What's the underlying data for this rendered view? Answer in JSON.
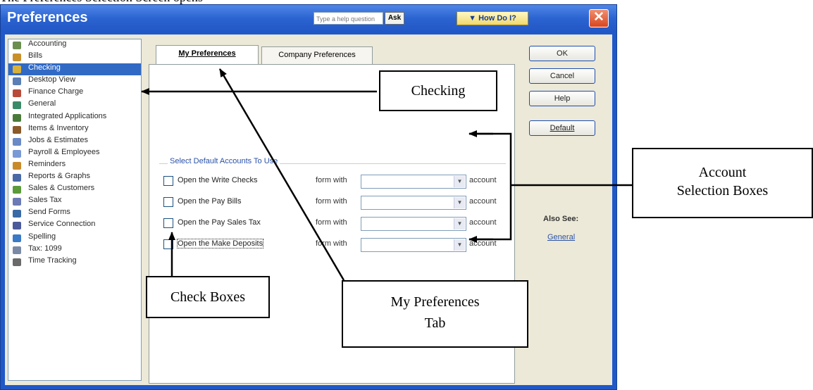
{
  "caption": "The Preferences Selection Screen opens",
  "window": {
    "title": "Preferences",
    "help_placeholder": "Type a help question",
    "ask_label": "Ask",
    "howdo_label": "▼ How Do I?",
    "close_glyph": "✕"
  },
  "sidebar": {
    "items": [
      {
        "label": "Accounting",
        "icon": "accounting-icon",
        "color": "#6b8e4e"
      },
      {
        "label": "Bills",
        "icon": "bills-icon",
        "color": "#c9902a"
      },
      {
        "label": "Checking",
        "icon": "checking-icon",
        "color": "#d8b13a",
        "selected": true
      },
      {
        "label": "Desktop View",
        "icon": "desktop-view-icon",
        "color": "#5a7fb6"
      },
      {
        "label": "Finance Charge",
        "icon": "finance-charge-icon",
        "color": "#b84a3a"
      },
      {
        "label": "General",
        "icon": "general-icon",
        "color": "#3a8a6a"
      },
      {
        "label": "Integrated Applications",
        "icon": "integrated-applications-icon",
        "color": "#4a7a3a"
      },
      {
        "label": "Items & Inventory",
        "icon": "items-inventory-icon",
        "color": "#8a5a2a"
      },
      {
        "label": "Jobs & Estimates",
        "icon": "jobs-estimates-icon",
        "color": "#6a8ac6"
      },
      {
        "label": "Payroll & Employees",
        "icon": "payroll-employees-icon",
        "color": "#7a9ad6"
      },
      {
        "label": "Reminders",
        "icon": "reminders-icon",
        "color": "#c98a2a"
      },
      {
        "label": "Reports & Graphs",
        "icon": "reports-graphs-icon",
        "color": "#4a6aa6"
      },
      {
        "label": "Sales & Customers",
        "icon": "sales-customers-icon",
        "color": "#5a9a3a"
      },
      {
        "label": "Sales Tax",
        "icon": "sales-tax-icon",
        "color": "#6a7ab6"
      },
      {
        "label": "Send Forms",
        "icon": "send-forms-icon",
        "color": "#3a6aa6"
      },
      {
        "label": "Service Connection",
        "icon": "service-connection-icon",
        "color": "#4a5a9a"
      },
      {
        "label": "Spelling",
        "icon": "spelling-icon",
        "color": "#3a7ac6"
      },
      {
        "label": "Tax: 1099",
        "icon": "tax-1099-icon",
        "color": "#7a8aa6"
      },
      {
        "label": "Time Tracking",
        "icon": "time-tracking-icon",
        "color": "#6a6a6a"
      }
    ]
  },
  "tabs": [
    {
      "label": "My Preferences",
      "active": true
    },
    {
      "label": "Company Preferences",
      "active": false
    }
  ],
  "group_label": "Select Default Accounts To Use",
  "rows": [
    {
      "label": "Open the Write Checks",
      "form_with": "form with",
      "value": "",
      "account": "account",
      "checked": false
    },
    {
      "label": "Open the Pay Bills",
      "form_with": "form with",
      "value": "",
      "account": "account",
      "checked": false
    },
    {
      "label": "Open the Pay Sales Tax",
      "form_with": "form with",
      "value": "",
      "account": "account",
      "checked": false
    },
    {
      "label": "Open the Make Deposits",
      "form_with": "form with",
      "value": "",
      "account": "account",
      "checked": false
    }
  ],
  "buttons": {
    "ok": "OK",
    "cancel": "Cancel",
    "help": "Help",
    "default": "Default"
  },
  "also_see": {
    "label": "Also See:",
    "link": "General"
  },
  "callouts": {
    "checking": "Checking",
    "account_boxes_line1": "Account",
    "account_boxes_line2": "Selection Boxes",
    "check_boxes": "Check Boxes",
    "my_prefs_line1": "My Preferences",
    "my_prefs_line2": "Tab"
  }
}
